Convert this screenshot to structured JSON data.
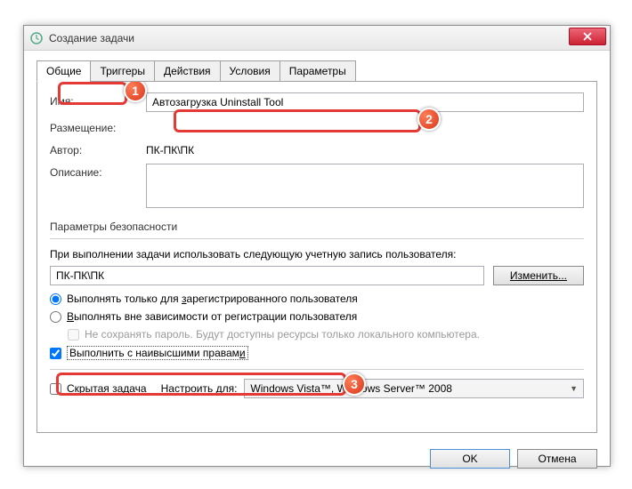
{
  "window": {
    "title": "Создание задачи"
  },
  "tabs": {
    "general": "Общие",
    "triggers": "Триггеры",
    "actions": "Действия",
    "conditions": "Условия",
    "settings": "Параметры"
  },
  "form": {
    "name_label": "Имя:",
    "name_value": "Автозагрузка Uninstall Tool",
    "location_label": "Размещение:",
    "author_label": "Автор:",
    "author_value": "ПК-ПК\\ПК",
    "description_label": "Описание:"
  },
  "security": {
    "legend": "Параметры безопасности",
    "use_account": "При выполнении задачи использовать следующую учетную запись пользователя:",
    "account_value": "ПК-ПК\\ПК",
    "change_btn": "Изменить...",
    "run_logged_pre": "Выполнять только для ",
    "run_logged_u": "з",
    "run_logged_post": "арегистрированного пользователя",
    "run_whether_u": "В",
    "run_whether_post": "ыполнять вне зависимости от регистрации пользователя",
    "nosave_pwd": "Не сохранять пароль. Будут доступны ресурсы только локального компьютера.",
    "highest_pre": "Выполнить с наивысшими правам",
    "highest_u": "и"
  },
  "hidden": {
    "u": "С",
    "post": "крытая задача"
  },
  "config": {
    "label": "Настроить для:",
    "value": "Windows Vista™, Windows Server™ 2008"
  },
  "buttons": {
    "ok": "OK",
    "cancel": "Отмена"
  },
  "callout": {
    "c1": "1",
    "c2": "2",
    "c3": "3"
  }
}
